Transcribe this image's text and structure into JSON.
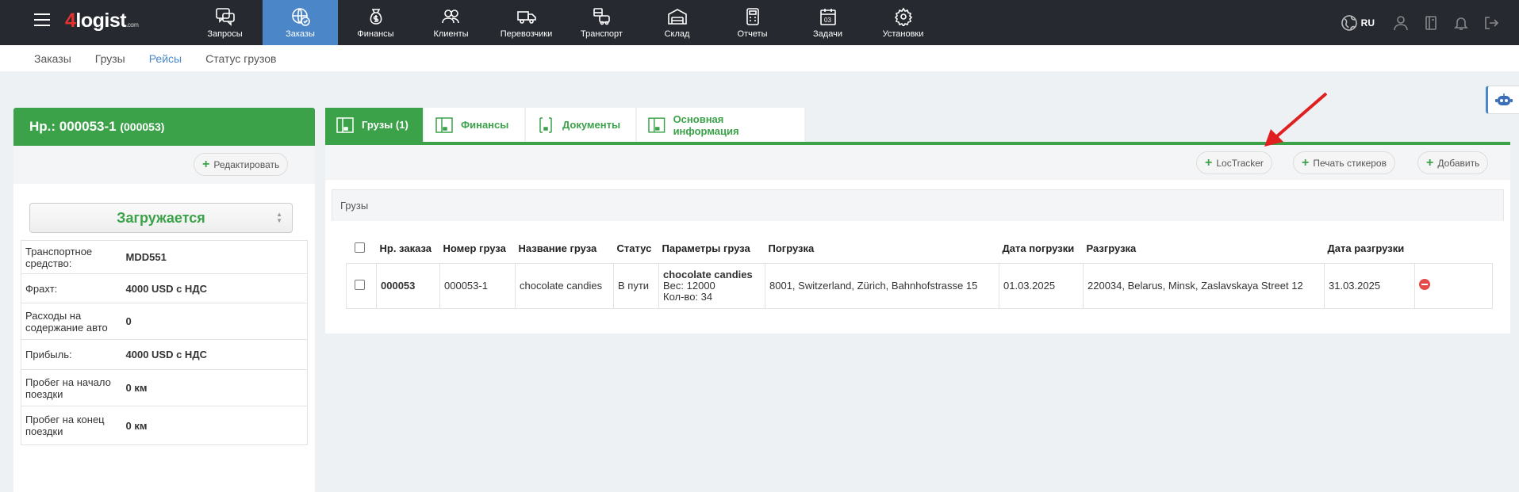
{
  "logo": {
    "number": "4",
    "text": "logist",
    "suffix": ".com"
  },
  "nav": [
    {
      "label": "Запросы",
      "icon": "chat-question-icon"
    },
    {
      "label": "Заказы",
      "icon": "globe-check-icon",
      "active": true
    },
    {
      "label": "Финансы",
      "icon": "money-bag-icon"
    },
    {
      "label": "Клиенты",
      "icon": "users-icon"
    },
    {
      "label": "Перевозчики",
      "icon": "truck-icon"
    },
    {
      "label": "Транспорт",
      "icon": "vehicles-icon"
    },
    {
      "label": "Склад",
      "icon": "warehouse-icon"
    },
    {
      "label": "Отчеты",
      "icon": "calculator-icon"
    },
    {
      "label": "Задачи",
      "icon": "calendar-icon"
    },
    {
      "label": "Установки",
      "icon": "gear-icon"
    }
  ],
  "nav_right": {
    "lang": "RU"
  },
  "subnav": [
    "Заказы",
    "Грузы",
    "Рейсы",
    "Статус грузов"
  ],
  "order": {
    "number": "Нр.: 000053-1",
    "sub": "(000053)",
    "edit_label": "Редактировать",
    "status": "Загружается",
    "info": [
      {
        "label": "Транспортное средство:",
        "value": "MDD551"
      },
      {
        "label": "Фрахт:",
        "value": "4000 USD с НДС"
      },
      {
        "label": "Расходы на содержание авто",
        "value": "0"
      },
      {
        "label": "Прибыль:",
        "value": "4000 USD с НДС"
      },
      {
        "label": "Пробег на начало поездки",
        "value": "0 км"
      },
      {
        "label": "Пробег на конец поездки",
        "value": "0 км"
      }
    ]
  },
  "tabs": [
    "Грузы (1)",
    "Финансы",
    "Документы",
    "Основная информация"
  ],
  "toolbar": {
    "loctracker": "LocTracker",
    "print": "Печать стикеров",
    "add": "Добавить"
  },
  "grid_title": "Грузы",
  "table": {
    "headers": [
      "Нр. заказа",
      "Номер груза",
      "Название груза",
      "Статус",
      "Параметры груза",
      "Погрузка",
      "Дата погрузки",
      "Разгрузка",
      "Дата разгрузки"
    ],
    "rows": [
      {
        "order": "000053",
        "cargo_no": "000053-1",
        "cargo_name": "chocolate candies",
        "status": "В пути",
        "params_title": "chocolate candies",
        "params_weight": "Вес: 12000",
        "params_qty": "Кол-во: 34",
        "loading": "8001, Switzerland, Zürich, Bahnhofstrasse 15",
        "loading_date": "01.03.2025",
        "unloading": "220034, Belarus, Minsk, Zaslavskaya Street 12",
        "unloading_date": "31.03.2025"
      }
    ]
  },
  "colors": {
    "green": "#3ba24a",
    "blue": "#4a86c8",
    "topbar": "#262a30",
    "arrow": "#e02020"
  }
}
